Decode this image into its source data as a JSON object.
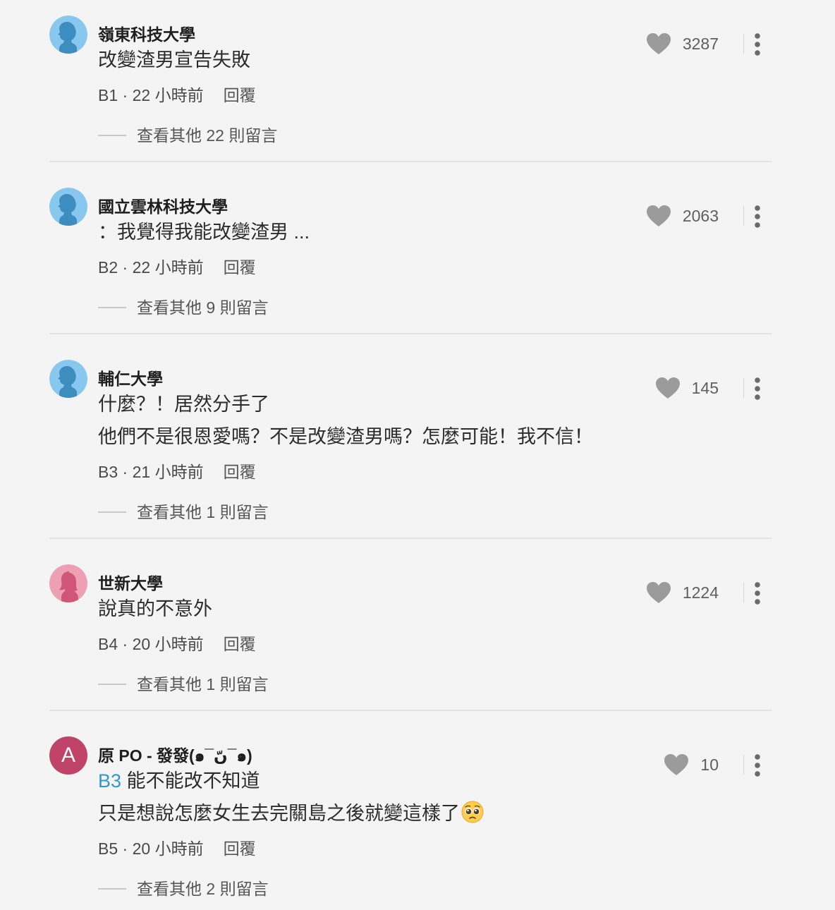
{
  "comments": [
    {
      "author": "嶺東科技大學",
      "avatar": "male-silhouette-icon",
      "avatar_bg": "#88c8ef",
      "avatar_fg": "#3e8dbf",
      "lines": [
        "改變渣男宣告失敗"
      ],
      "floor": "B1",
      "time": "22 小時前",
      "reply_label": "回覆",
      "likes": "3287",
      "more_replies": "查看其他 22 則留言"
    },
    {
      "author": "國立雲林科技大學",
      "avatar": "male-silhouette-icon",
      "avatar_bg": "#88c8ef",
      "avatar_fg": "#3e8dbf",
      "lines": [
        "：我覺得我能改變渣男 ..."
      ],
      "floor": "B2",
      "time": "22 小時前",
      "reply_label": "回覆",
      "likes": "2063",
      "more_replies": "查看其他 9 則留言"
    },
    {
      "author": "輔仁大學",
      "avatar": "male-silhouette-icon",
      "avatar_bg": "#88c8ef",
      "avatar_fg": "#3e8dbf",
      "lines": [
        "什麼？！居然分手了",
        "他們不是很恩愛嗎？不是改變渣男嗎？怎麼可能！我不信！"
      ],
      "floor": "B3",
      "time": "21 小時前",
      "reply_label": "回覆",
      "likes": "145",
      "more_replies": "查看其他 1 則留言"
    },
    {
      "author": "世新大學",
      "avatar": "female-silhouette-icon",
      "avatar_bg": "#eda0b4",
      "avatar_fg": "#d05677",
      "lines": [
        "說真的不意外"
      ],
      "floor": "B4",
      "time": "20 小時前",
      "reply_label": "回覆",
      "likes": "1224",
      "more_replies": "查看其他 1 則留言"
    },
    {
      "author": "原 PO - 發發(๑¯ںّ¯๑)",
      "avatar": "letter-avatar",
      "avatar_letter": "A",
      "avatar_bg": "#c0436a",
      "mention": "B3",
      "lines": [
        "能不能改不知道",
        "只是想說怎麼女生去完關島之後就變這樣了"
      ],
      "emoji": "pleading-face-emoji",
      "floor": "B5",
      "time": "20 小時前",
      "reply_label": "回覆",
      "likes": "10",
      "more_replies": "查看其他 2 則留言"
    }
  ],
  "colors": {
    "background": "#f4f4f4",
    "mention": "#3397cf",
    "heart": "#9b9b9b",
    "divider": "#e3e3e3"
  }
}
